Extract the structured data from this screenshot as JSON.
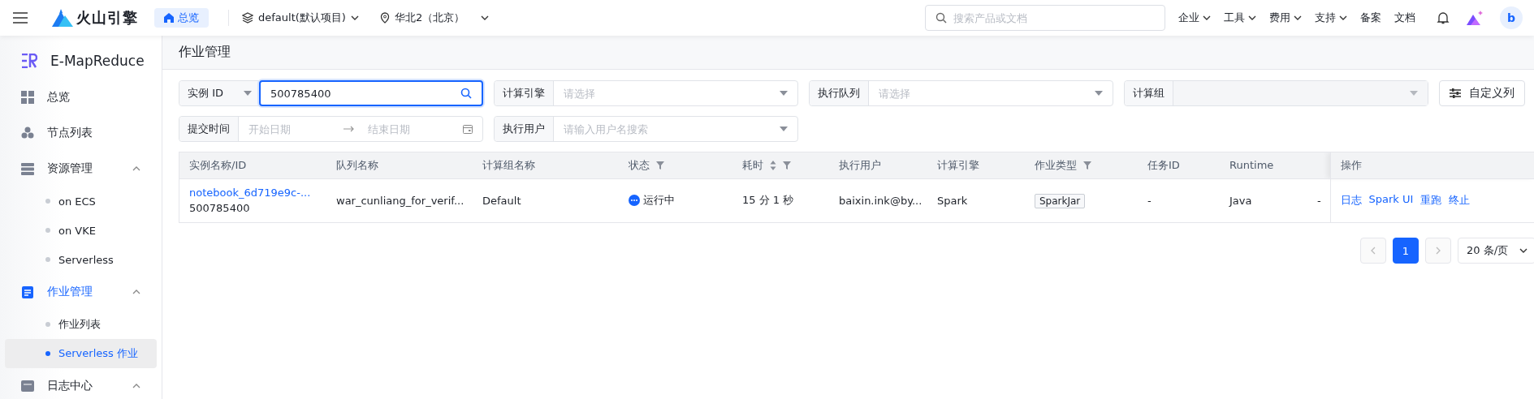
{
  "topbar": {
    "brand": "火山引擎",
    "home": "总览",
    "project": "default(默认项目)",
    "region": "华北2（北京）",
    "search": {
      "placeholder": "搜索产品或文档"
    },
    "menu": [
      {
        "label": "企业",
        "dropdown": true
      },
      {
        "label": "工具",
        "dropdown": true
      },
      {
        "label": "费用",
        "dropdown": true
      },
      {
        "label": "支持",
        "dropdown": true
      },
      {
        "label": "备案",
        "dropdown": false
      },
      {
        "label": "文档",
        "dropdown": false
      }
    ],
    "avatar": "b"
  },
  "sidebar": {
    "product": "E-MapReduce",
    "items": [
      {
        "label": "总览",
        "selected": false
      },
      {
        "label": "节点列表",
        "selected": false
      },
      {
        "label": "资源管理",
        "selected": false,
        "expanded": true,
        "children": [
          {
            "label": "on ECS",
            "selected": false
          },
          {
            "label": "on VKE",
            "selected": false
          },
          {
            "label": "Serverless",
            "selected": false
          }
        ]
      },
      {
        "label": "作业管理",
        "selected": true,
        "expanded": true,
        "children": [
          {
            "label": "作业列表",
            "selected": false
          },
          {
            "label": "Serverless 作业",
            "selected": true
          }
        ]
      },
      {
        "label": "日志中心",
        "selected": false,
        "expanded": true
      }
    ]
  },
  "page_title": "作业管理",
  "filters": [
    [
      {
        "kind": "search",
        "label": "实例 ID",
        "value": "500785400"
      },
      {
        "kind": "select",
        "label": "计算引擎",
        "placeholder": "请选择",
        "disabled": false
      },
      {
        "kind": "select",
        "label": "执行队列",
        "placeholder": "请选择",
        "disabled": false
      },
      {
        "kind": "select",
        "label": "计算组",
        "disabled": true
      },
      {
        "kind": "button",
        "label": "自定义列"
      }
    ],
    [
      {
        "kind": "daterange",
        "label": "提交时间",
        "start_placeholder": "开始日期",
        "end_placeholder": "结束日期"
      },
      {
        "kind": "select",
        "label": "执行用户",
        "placeholder": "请输入用户名搜索",
        "disabled": false
      }
    ]
  ],
  "table": {
    "columns": [
      {
        "label": "实例名称/ID"
      },
      {
        "label": "队列名称"
      },
      {
        "label": "计算组名称"
      },
      {
        "label": "状态",
        "filter": true
      },
      {
        "label": "耗时",
        "sort": true,
        "filter": true
      },
      {
        "label": "执行用户"
      },
      {
        "label": "计算引擎"
      },
      {
        "label": "作业类型",
        "filter": true
      },
      {
        "label": "任务ID"
      },
      {
        "label": "Runtime"
      },
      {},
      {
        "label": "操作"
      }
    ],
    "rows": [
      {
        "name": "notebook_6d719e9c-...",
        "id": "500785400",
        "queue": "war_cunliang_for_verif...",
        "group": "Default",
        "status": {
          "kind": "running",
          "label": "运行中"
        },
        "duration": "15 分 1 秒",
        "user": "baixin.ink@by...",
        "engine": "Spark",
        "type": "SparkJar",
        "task_id": "-",
        "runtime": "Java",
        "column_11": "-",
        "actions": [
          "日志",
          "Spark UI",
          "重跑",
          "终止"
        ]
      }
    ]
  },
  "pagination": {
    "pages": [
      {
        "label": "1",
        "selected": true
      }
    ],
    "page_size": "20 条/页"
  }
}
